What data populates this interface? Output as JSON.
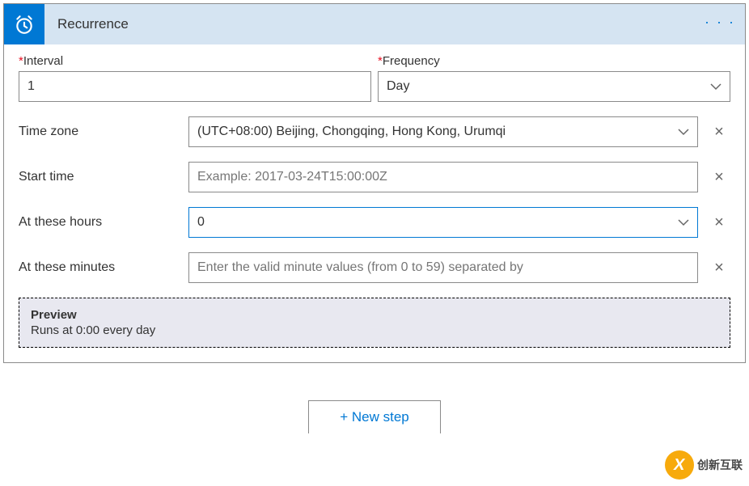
{
  "header": {
    "title": "Recurrence",
    "menu_dots": "· · ·"
  },
  "top": {
    "interval_label": "Interval",
    "interval_value": "1",
    "frequency_label": "Frequency",
    "frequency_value": "Day"
  },
  "rows": {
    "timezone_label": "Time zone",
    "timezone_value": "(UTC+08:00) Beijing, Chongqing, Hong Kong, Urumqi",
    "starttime_label": "Start time",
    "starttime_placeholder": "Example: 2017-03-24T15:00:00Z",
    "starttime_value": "",
    "hours_label": "At these hours",
    "hours_value": "0",
    "minutes_label": "At these minutes",
    "minutes_placeholder": "Enter the valid minute values (from 0 to 59) separated by",
    "minutes_value": "",
    "clear_symbol": "×"
  },
  "preview": {
    "title": "Preview",
    "text": "Runs at 0:00 every day"
  },
  "footer": {
    "new_step": "+ New step"
  },
  "watermark": {
    "cn": "创新互联"
  }
}
